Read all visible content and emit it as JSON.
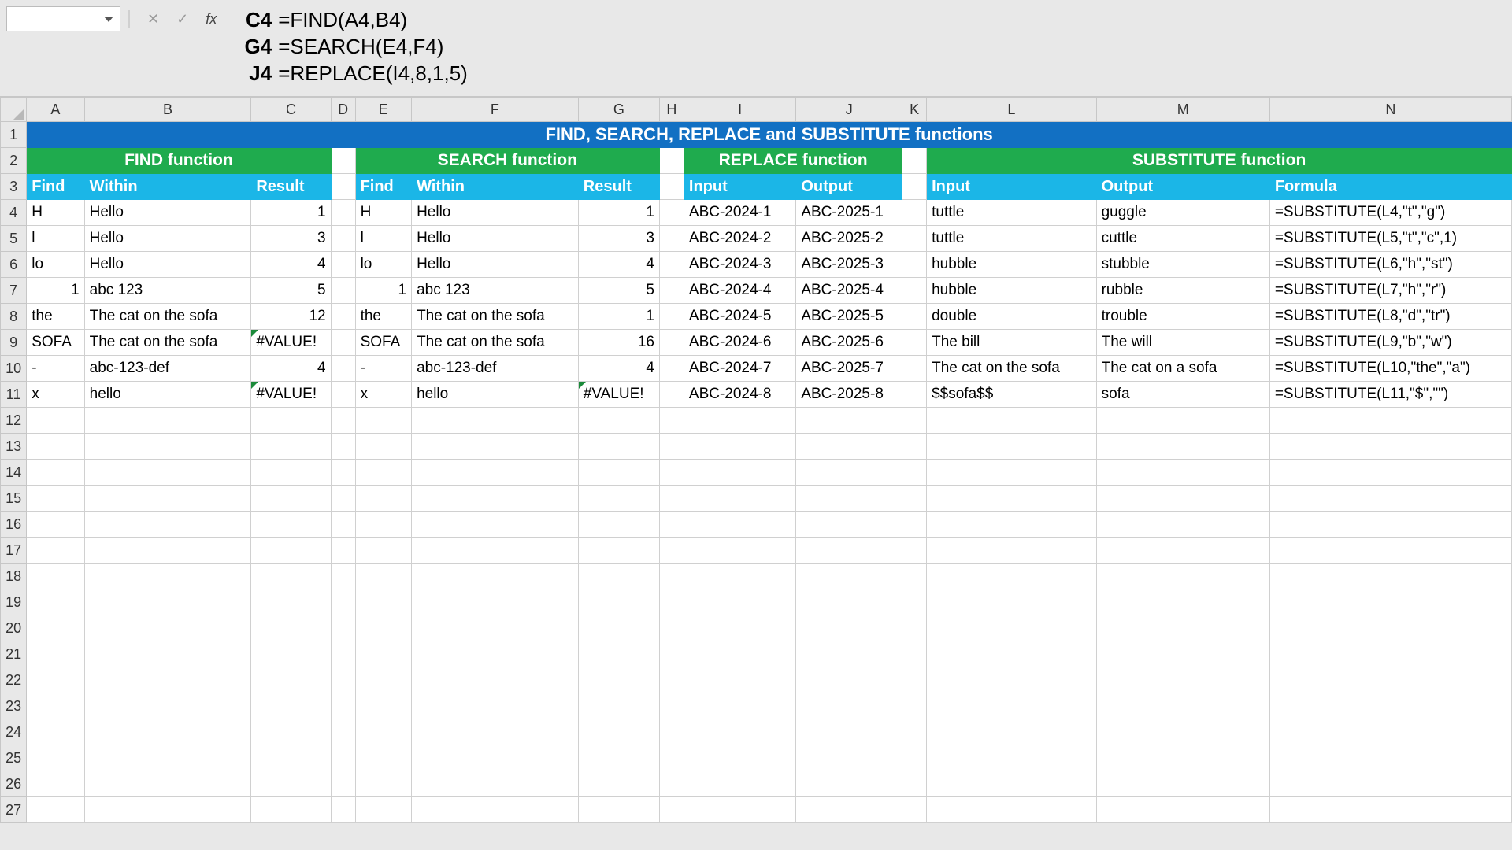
{
  "formula_bar": {
    "lines": [
      {
        "ref": "C4",
        "formula": "=FIND(A4,B4)"
      },
      {
        "ref": "G4",
        "formula": "=SEARCH(E4,F4)"
      },
      {
        "ref": "J4",
        "formula": "=REPLACE(I4,8,1,5)"
      }
    ]
  },
  "title": "FIND, SEARCH, REPLACE and SUBSTITUTE functions",
  "sections": {
    "find": "FIND function",
    "search": "SEARCH function",
    "replace": "REPLACE function",
    "substitute": "SUBSTITUTE function"
  },
  "headers": {
    "find": "Find",
    "within": "Within",
    "result": "Result",
    "input": "Input",
    "output": "Output",
    "formula": "Formula"
  },
  "col_letters": [
    "A",
    "B",
    "C",
    "D",
    "E",
    "F",
    "G",
    "H",
    "I",
    "J",
    "K",
    "L",
    "M",
    "N"
  ],
  "rows": [
    {
      "A": "H",
      "B": "Hello",
      "C": "1",
      "E": "H",
      "F": "Hello",
      "G": "1",
      "I": "ABC-2024-1",
      "J": "ABC-2025-1",
      "L": "tuttle",
      "M": "guggle",
      "N": "=SUBSTITUTE(L4,\"t\",\"g\")"
    },
    {
      "A": "l",
      "B": "Hello",
      "C": "3",
      "E": "l",
      "F": "Hello",
      "G": "3",
      "I": "ABC-2024-2",
      "J": "ABC-2025-2",
      "L": "tuttle",
      "M": "cuttle",
      "N": "=SUBSTITUTE(L5,\"t\",\"c\",1)"
    },
    {
      "A": "lo",
      "B": "Hello",
      "C": "4",
      "E": "lo",
      "F": "Hello",
      "G": "4",
      "I": "ABC-2024-3",
      "J": "ABC-2025-3",
      "L": "hubble",
      "M": "stubble",
      "N": "=SUBSTITUTE(L6,\"h\",\"st\")"
    },
    {
      "A": "1",
      "B": "abc 123",
      "C": "5",
      "E": "1",
      "F": "abc 123",
      "G": "5",
      "I": "ABC-2024-4",
      "J": "ABC-2025-4",
      "L": "hubble",
      "M": "rubble",
      "N": "=SUBSTITUTE(L7,\"h\",\"r\")"
    },
    {
      "A": "the",
      "B": "The cat on the sofa",
      "C": "12",
      "E": "the",
      "F": "The cat on the sofa",
      "G": "1",
      "I": "ABC-2024-5",
      "J": "ABC-2025-5",
      "L": "double",
      "M": "trouble",
      "N": "=SUBSTITUTE(L8,\"d\",\"tr\")"
    },
    {
      "A": "SOFA",
      "B": "The cat on the sofa",
      "C": "#VALUE!",
      "E": "SOFA",
      "F": "The cat on the sofa",
      "G": "16",
      "I": "ABC-2024-6",
      "J": "ABC-2025-6",
      "L": "The bill",
      "M": "The will",
      "N": "=SUBSTITUTE(L9,\"b\",\"w\")"
    },
    {
      "A": "-",
      "B": "abc-123-def",
      "C": "4",
      "E": "-",
      "F": "abc-123-def",
      "G": "4",
      "I": "ABC-2024-7",
      "J": "ABC-2025-7",
      "L": "The cat on the sofa",
      "M": "The cat on a sofa",
      "N": "=SUBSTITUTE(L10,\"the\",\"a\")"
    },
    {
      "A": "x",
      "B": "hello",
      "C": "#VALUE!",
      "E": "x",
      "F": "hello",
      "G": "#VALUE!",
      "I": "ABC-2024-8",
      "J": "ABC-2025-8",
      "L": "$$sofa$$",
      "M": "sofa",
      "N": "=SUBSTITUTE(L11,\"$\",\"\")"
    }
  ],
  "err_cells": [
    "C9",
    "C11",
    "G11"
  ],
  "num_cells_row7": true
}
